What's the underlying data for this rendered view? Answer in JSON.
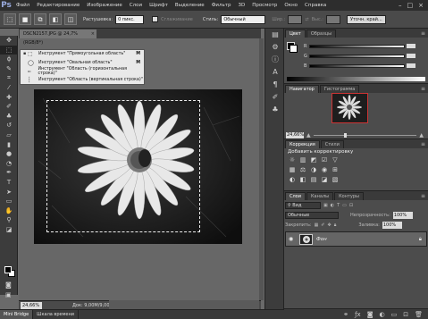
{
  "app": {
    "logo": "Ps",
    "menu": [
      "Файл",
      "Редактирование",
      "Изображение",
      "Слои",
      "Шрифт",
      "Выделение",
      "Фильтр",
      "3D",
      "Просмотр",
      "Окно",
      "Справка"
    ],
    "window_controls": [
      "–",
      "□",
      "×"
    ]
  },
  "options_bar": {
    "feather_label": "Растушевка:",
    "feather_value": "0 пикс.",
    "antialias_label": "Сглаживание",
    "style_label": "Стиль:",
    "style_value": "Обычный",
    "width_label": "Шир.:",
    "height_label": "Выс.:",
    "refine_button": "Уточн. край..."
  },
  "document": {
    "tab_title": "DSCN2157.JPG @ 24,7% (RGB/8*)",
    "close_glyph": "×",
    "zoom": "24,66%",
    "doc_info": "Док: 9,00M/9,00M"
  },
  "marquee_flyout": {
    "items": [
      {
        "label": "Инструмент \"Прямоугольная область\"",
        "key": "M",
        "icon": "rect-marquee-icon",
        "glyph": "⬚",
        "active": true
      },
      {
        "label": "Инструмент \"Овальная область\"",
        "key": "M",
        "icon": "ellipse-marquee-icon",
        "glyph": "◯",
        "active": false
      },
      {
        "label": "Инструмент \"Область (горизонтальная строка)\"",
        "key": "",
        "icon": "single-row-marquee-icon",
        "glyph": "┅",
        "active": false
      },
      {
        "label": "Инструмент \"Область (вертикальная строка)\"",
        "key": "",
        "icon": "single-column-marquee-icon",
        "glyph": "┆",
        "active": false
      }
    ]
  },
  "bottom_tabs": [
    "Mini Bridge",
    "Шкала времени"
  ],
  "color_panel": {
    "tabs": [
      "Цвет",
      "Образцы"
    ],
    "channels": [
      "R",
      "G",
      "B"
    ]
  },
  "navigator_panel": {
    "tabs": [
      "Навигатор",
      "Гистограмма"
    ],
    "zoom": "24,66%"
  },
  "adjustments_panel": {
    "tabs": [
      "Коррекция",
      "Стили"
    ],
    "title": "Добавить корректировку",
    "rows": [
      [
        "☼",
        "▥",
        "◩",
        "☑",
        "▽"
      ],
      [
        "▦",
        "⚖",
        "◑",
        "◉",
        "⊞"
      ],
      [
        "◐",
        "◧",
        "▤",
        "◪",
        "▧"
      ]
    ]
  },
  "layers_panel": {
    "tabs": [
      "Слои",
      "Каналы",
      "Контуры"
    ],
    "filter_label": "Вид",
    "blend_mode": "Обычные",
    "opacity_label": "Непрозрачность:",
    "opacity_value": "100%",
    "lock_label": "Закрепить:",
    "fill_label": "Заливка:",
    "fill_value": "100%",
    "layer_name": "Фон"
  },
  "colors": {
    "accent_nav_box": "#cc3333"
  }
}
